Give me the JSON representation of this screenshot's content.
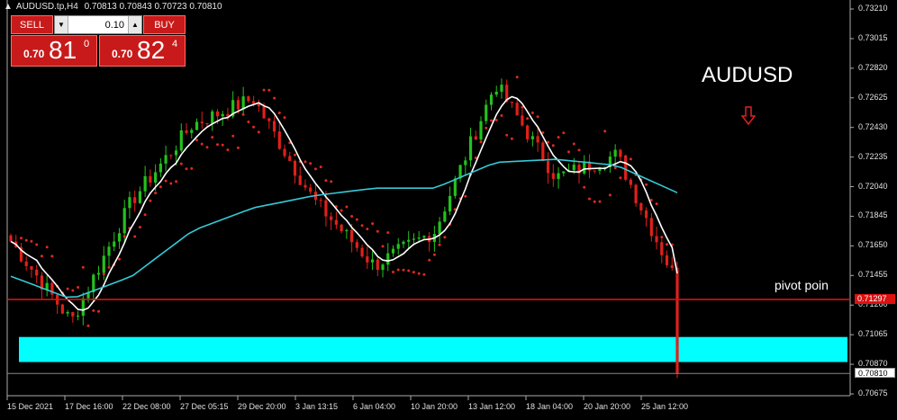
{
  "window": {
    "symbol_line": "AUDUSD.tp,H4",
    "ohlc": "0.70813 0.70843 0.70723 0.70810"
  },
  "trade_panel": {
    "sell_label": "SELL",
    "buy_label": "BUY",
    "lot_value": "0.10",
    "sell_price_prefix": "0.70",
    "sell_price_big": "81",
    "sell_price_sup": "0",
    "buy_price_prefix": "0.70",
    "buy_price_big": "82",
    "buy_price_sup": "4"
  },
  "annotations": {
    "symbol_title": "AUDUSD",
    "pivot_label": "pivot poin",
    "arrow_icon": "down-arrow-icon"
  },
  "price_axis": {
    "ticks": [
      "0.73210",
      "0.73015",
      "0.72820",
      "0.72625",
      "0.72430",
      "0.72235",
      "0.72040",
      "0.71845",
      "0.71650",
      "0.71455",
      "0.71260",
      "0.71065",
      "0.70870",
      "0.70675"
    ],
    "pivot_price": "0.71297",
    "bid_price": "0.70810"
  },
  "time_axis": {
    "labels": [
      "15 Dec 2021",
      "17 Dec 16:00",
      "22 Dec 08:00",
      "27 Dec 05:15",
      "29 Dec 20:00",
      "3 Jan 13:15",
      "6 Jan 04:00",
      "10 Jan 20:00",
      "13 Jan 12:00",
      "18 Jan 04:00",
      "20 Jan 20:00",
      "25 Jan 12:00"
    ]
  },
  "colors": {
    "bull": "#22c21d",
    "bear": "#e0201a",
    "support_zone": "#00ffff",
    "pivot_line": "#d11515",
    "ma_fast": "#ffffff",
    "ma_slow": "#35c9d6",
    "sar": "#e02a1d",
    "panel_red": "#c81a1a"
  },
  "chart_data": {
    "type": "line",
    "title": "AUDUSD",
    "ylim": [
      0.70675,
      0.7321
    ],
    "x": [
      "15 Dec 2021",
      "17 Dec 16:00",
      "22 Dec 08:00",
      "27 Dec 05:15",
      "29 Dec 20:00",
      "3 Jan 13:15",
      "6 Jan 04:00",
      "10 Jan 20:00",
      "13 Jan 12:00",
      "18 Jan 04:00",
      "20 Jan 20:00",
      "25 Jan 12:00"
    ],
    "series": [
      {
        "values": [
          0.7168,
          0.7115,
          0.7195,
          0.7245,
          0.7262,
          0.7195,
          0.7152,
          0.7175,
          0.7272,
          0.721,
          0.7225,
          0.714
        ]
      },
      {
        "values": [
          0.7145,
          0.713,
          0.7145,
          0.7175,
          0.719,
          0.7198,
          0.7203,
          0.7203,
          0.722,
          0.7222,
          0.7218,
          0.72
        ]
      }
    ],
    "pivot_level": 0.71297,
    "support_zone": [
      0.70885,
      0.7105
    ],
    "last_price": 0.7081,
    "grid": false
  }
}
